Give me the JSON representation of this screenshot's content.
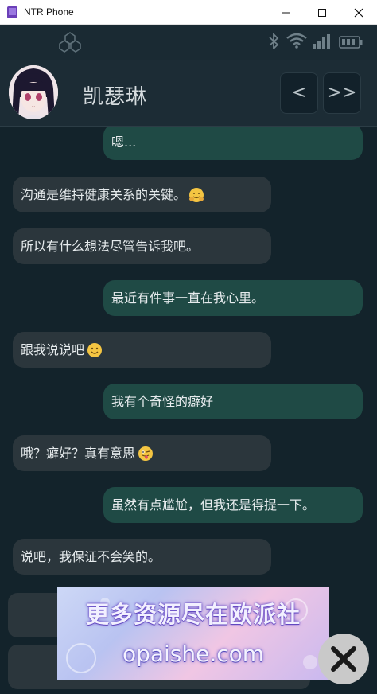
{
  "window": {
    "title": "NTR Phone"
  },
  "status_icons": [
    "network-cube-icon",
    "bluetooth-icon",
    "wifi-icon",
    "signal-icon",
    "battery-icon"
  ],
  "contact": {
    "name": "凯瑟琳",
    "back_label": "<",
    "skip_label": ">>"
  },
  "messages": [
    {
      "side": "out",
      "text": "嗯..."
    },
    {
      "side": "in",
      "text": "沟通是维持健康关系的关键。",
      "emoji": "hugging-face-emoji"
    },
    {
      "side": "in",
      "text": "所以有什么想法尽管告诉我吧。"
    },
    {
      "side": "out",
      "text": "最近有件事一直在我心里。"
    },
    {
      "side": "in",
      "text": "跟我说说吧",
      "emoji": "smiling-face-emoji"
    },
    {
      "side": "out",
      "text": "我有个奇怪的癖好"
    },
    {
      "side": "in",
      "text": "哦？癖好？真有意思",
      "emoji": "winking-tongue-emoji"
    },
    {
      "side": "out",
      "text": "虽然有点尴尬，但我还是得提一下。"
    },
    {
      "side": "in",
      "text": "说吧，我保证不会笑的。"
    }
  ],
  "watermark": {
    "line1": "更多资源尽在欧派社",
    "line2": "opaishe.com"
  },
  "close_button": {
    "icon": "close-x-icon"
  },
  "colors": {
    "incoming": "#2b363c",
    "outgoing": "#1f4a45",
    "background": "#13232b"
  }
}
